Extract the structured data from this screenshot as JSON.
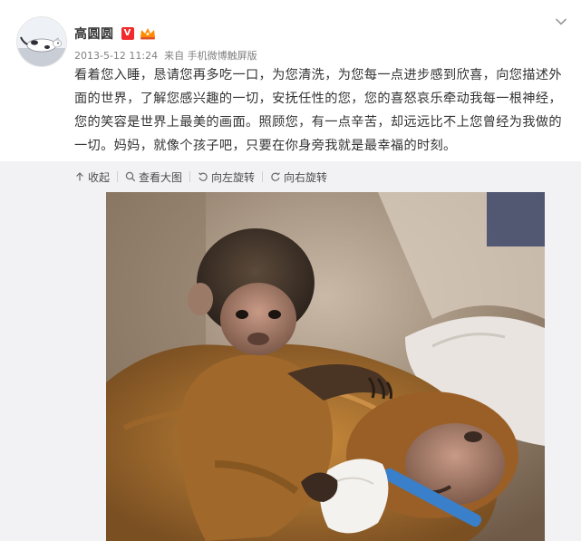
{
  "user": {
    "name": "高圆圆",
    "vip_badge": "V",
    "avatar_icon": "avatar-cat-photo"
  },
  "meta": {
    "timestamp": "2013-5-12 11:24",
    "source_prefix": "来自",
    "source": "手机微博触屏版"
  },
  "post": {
    "text": "看着您入睡，恳请您再多吃一口，为您清洗，为您每一点进步感到欣喜，向您描述外面的世界，了解您感兴趣的一切，安抚任性的您，您的喜怒哀乐牵动我每一根神经，您的笑容是世界上最美的画面。照顾您，有一点辛苦，却远远比不上您曾经为我做的一切。妈妈，就像个孩子吧，只要在你身旁我就是最幸福的时刻。"
  },
  "actions": {
    "collapse_label": "收起",
    "view_large_label": "查看大图",
    "rotate_left_label": "向左旋转",
    "rotate_right_label": "向右旋转"
  },
  "photo": {
    "subject_icon": "monkeys-photo"
  },
  "colors": {
    "text": "#333333",
    "meta": "#808080",
    "panel_bg": "#f2f2f5",
    "vip_red": "#f12b2b",
    "crown_orange": "#ff8a00"
  }
}
